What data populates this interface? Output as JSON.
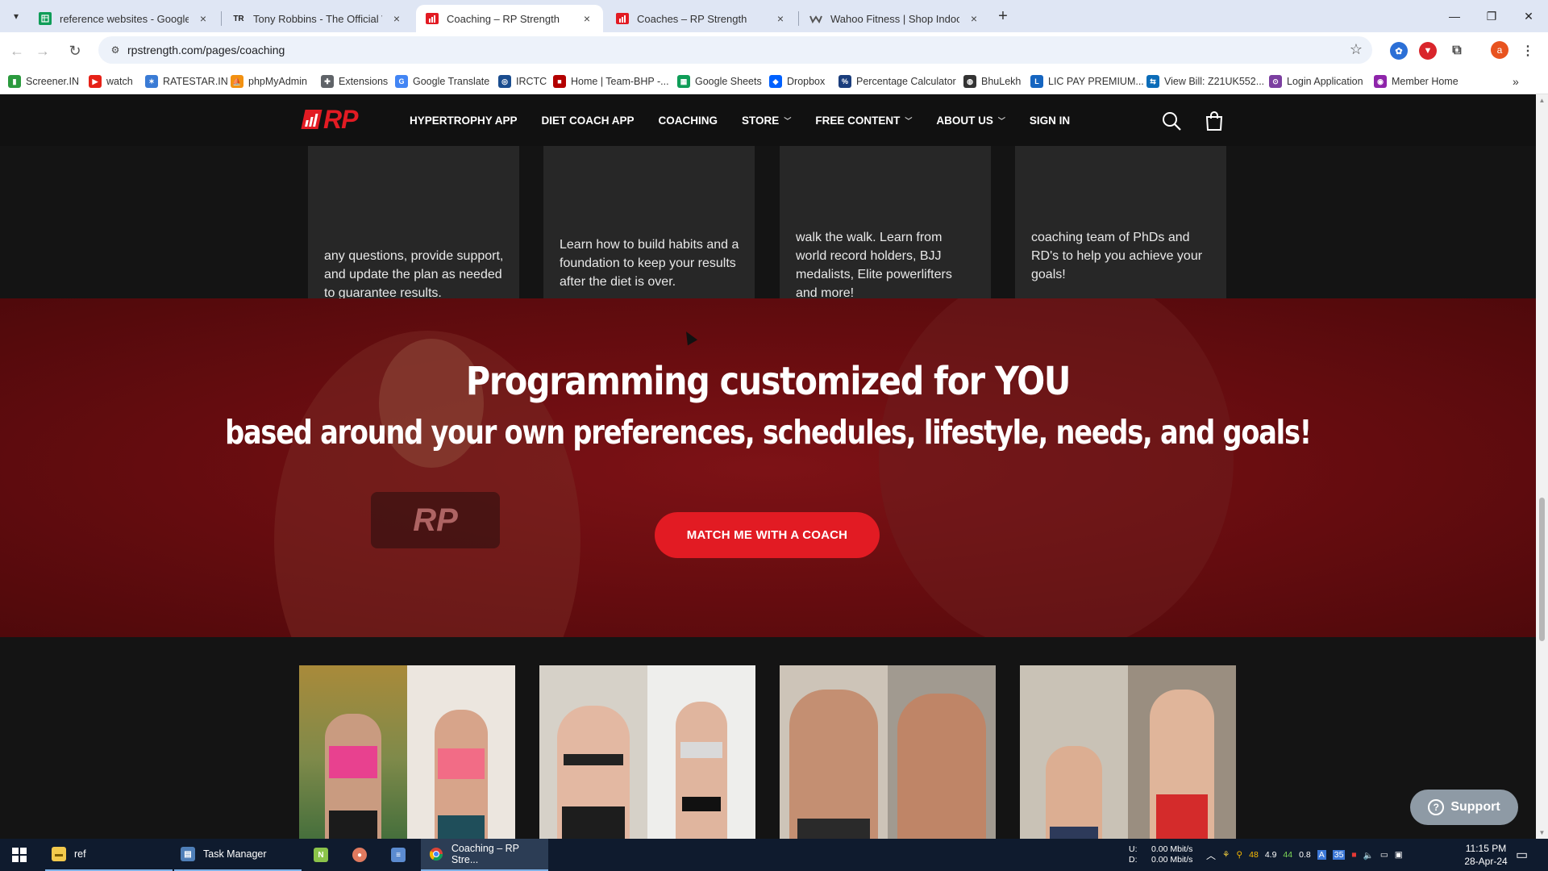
{
  "browser": {
    "tabs": [
      {
        "title": "reference websites - Google Sh",
        "icon": "sheets-icon",
        "color": "#0f9d58"
      },
      {
        "title": "Tony Robbins - The Official Wel",
        "icon": "tr-icon",
        "color": "#222222"
      },
      {
        "title": "Coaching – RP Strength",
        "icon": "rp-icon",
        "color": "#e21b23"
      },
      {
        "title": "Coaches – RP Strength",
        "icon": "rp-icon",
        "color": "#e21b23"
      },
      {
        "title": "Wahoo Fitness | Shop Indoor Bi",
        "icon": "wahoo-icon",
        "color": "#555555"
      }
    ],
    "active_tab_index": 2,
    "url": "rpstrength.com/pages/coaching",
    "profile_initial": "a",
    "tr_glyph": "TR"
  },
  "bookmarks": [
    {
      "label": "Screener.IN",
      "color": "#2b9a3e"
    },
    {
      "label": "watch",
      "color": "#e62117"
    },
    {
      "label": "RATESTAR.IN",
      "color": "#3a7bd5"
    },
    {
      "label": "phpMyAdmin",
      "color": "#f29111"
    },
    {
      "label": "Extensions",
      "color": "#5f6368"
    },
    {
      "label": "Google Translate",
      "color": "#4285f4"
    },
    {
      "label": "IRCTC",
      "color": "#1a4d8f"
    },
    {
      "label": "Home | Team-BHP -...",
      "color": "#b30000"
    },
    {
      "label": "Google Sheets",
      "color": "#0f9d58"
    },
    {
      "label": "Dropbox",
      "color": "#0061ff"
    },
    {
      "label": "Percentage Calculator",
      "color": "#1a3d7c"
    },
    {
      "label": "BhuLekh",
      "color": "#333333"
    },
    {
      "label": "LIC PAY PREMIUM...",
      "color": "#1565c0"
    },
    {
      "label": "View Bill: Z21UK552...",
      "color": "#0b6cb8"
    },
    {
      "label": "Login Application",
      "color": "#7b3fa0"
    },
    {
      "label": "Member Home",
      "color": "#8e24aa"
    }
  ],
  "site": {
    "logo_text": "RP",
    "nav": [
      {
        "label": "HYPERTROPHY APP",
        "dropdown": false
      },
      {
        "label": "DIET COACH APP",
        "dropdown": false
      },
      {
        "label": "COACHING",
        "dropdown": false
      },
      {
        "label": "STORE",
        "dropdown": true
      },
      {
        "label": "FREE CONTENT",
        "dropdown": true
      },
      {
        "label": "ABOUT US",
        "dropdown": true
      },
      {
        "label": "SIGN IN",
        "dropdown": false
      }
    ],
    "cards": [
      "any questions, provide support, and update the plan as needed to guarantee results.",
      "Learn how to build habits and a foundation to keep your results after the diet is over.",
      "walk the walk. Learn from world record holders, BJJ medalists, Elite powerlifters and more!",
      "coaching team of PhDs and RD's to help you achieve your goals!"
    ],
    "hero": {
      "title": "Programming customized for YOU",
      "subtitle": "based around your own preferences, schedules, lifestyle, needs, and goals!",
      "cta": "MATCH ME WITH A COACH",
      "shirt_logo": "RP"
    },
    "support_label": "Support"
  },
  "taskbar": {
    "items": [
      {
        "label": "ref",
        "icon": "folder-icon"
      },
      {
        "label": "Task Manager",
        "icon": "task-manager-icon"
      },
      {
        "label": "",
        "icon": "notepad-plus-icon"
      },
      {
        "label": "",
        "icon": "app-icon"
      },
      {
        "label": "",
        "icon": "document-icon"
      },
      {
        "label": "Coaching – RP Stre...",
        "icon": "chrome-icon"
      }
    ],
    "net_up": "0.00 Mbit/s",
    "net_down": "0.00 Mbit/s",
    "net_up_label": "U:",
    "net_down_label": "D:",
    "tray_numbers": [
      "48",
      "4.9",
      "44",
      "0.8"
    ],
    "time": "11:15 PM",
    "date": "28-Apr-24",
    "tray_badge": "35"
  },
  "colors": {
    "brand_red": "#e21b23",
    "hero_red": "#6a0d10",
    "nav_bg": "#111111"
  }
}
